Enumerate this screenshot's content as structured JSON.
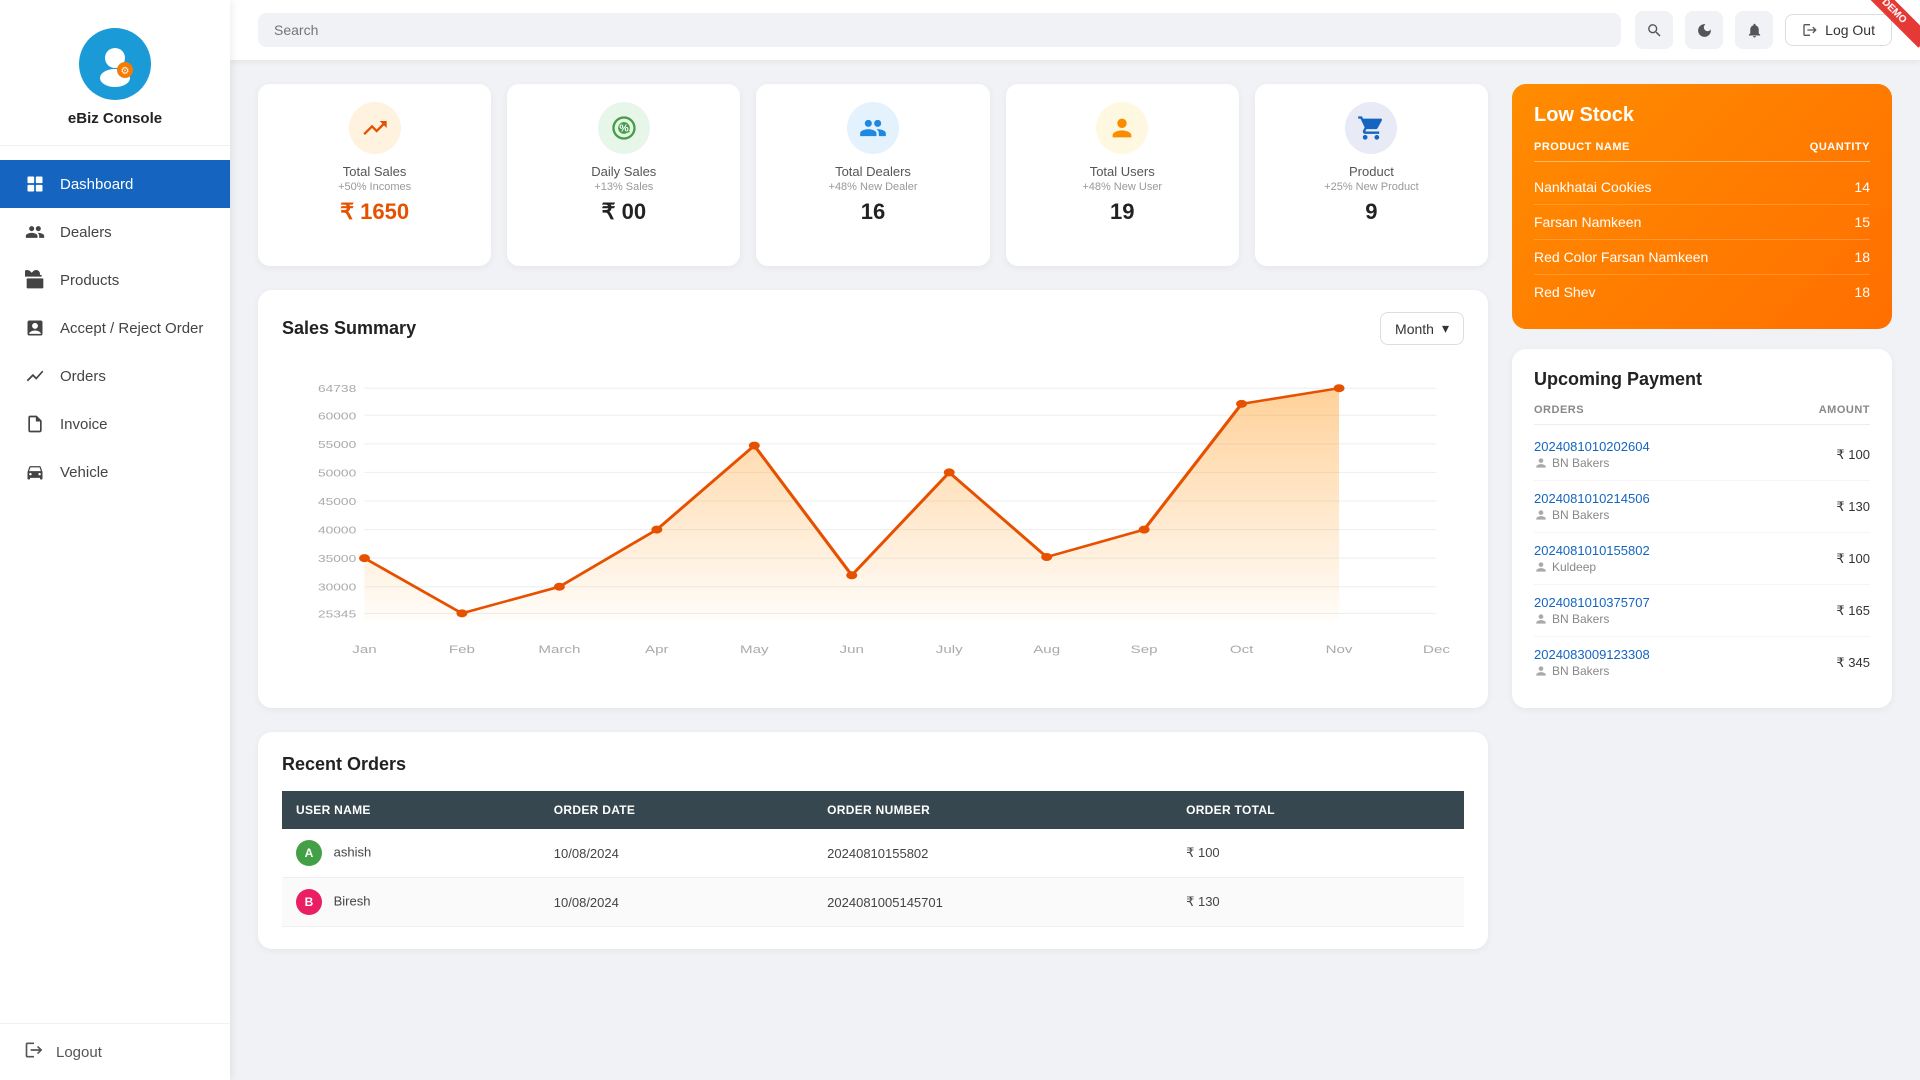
{
  "brand": "eBiz Console",
  "topbar": {
    "search_placeholder": "Search",
    "logout_label": "Log Out"
  },
  "sidebar": {
    "items": [
      {
        "id": "dashboard",
        "label": "Dashboard",
        "active": true
      },
      {
        "id": "dealers",
        "label": "Dealers"
      },
      {
        "id": "products",
        "label": "Products"
      },
      {
        "id": "accept-reject",
        "label": "Accept / Reject Order"
      },
      {
        "id": "orders",
        "label": "Orders"
      },
      {
        "id": "invoice",
        "label": "Invoice"
      },
      {
        "id": "vehicle",
        "label": "Vehicle"
      }
    ],
    "logout": "Logout"
  },
  "stats": [
    {
      "id": "total-sales",
      "icon_color": "#e65100",
      "icon": "chart-up",
      "label": "Total Sales",
      "sub": "+50% Incomes",
      "value": "₹ 1650",
      "orange": true
    },
    {
      "id": "daily-sales",
      "icon_color": "#43a047",
      "icon": "percent",
      "label": "Daily Sales",
      "sub": "+13% Sales",
      "value": "₹ 00",
      "orange": false
    },
    {
      "id": "total-dealers",
      "icon_color": "#1e88e5",
      "icon": "group",
      "label": "Total Dealers",
      "sub": "+48% New Dealer",
      "value": "16",
      "orange": false
    },
    {
      "id": "total-users",
      "icon_color": "#fb8c00",
      "icon": "person",
      "label": "Total Users",
      "sub": "+48% New User",
      "value": "19",
      "orange": false
    },
    {
      "id": "product",
      "icon_color": "#1565c0",
      "icon": "cart",
      "label": "Product",
      "sub": "+25% New Product",
      "value": "9",
      "orange": false
    }
  ],
  "low_stock": {
    "title": "Low Stock",
    "col_name": "PRODUCT NAME",
    "col_qty": "QUANTITY",
    "items": [
      {
        "name": "Nankhatai Cookies",
        "qty": 14
      },
      {
        "name": "Farsan Namkeen",
        "qty": 15
      },
      {
        "name": "Red Color Farsan Namkeen",
        "qty": 18
      },
      {
        "name": "Red Shev",
        "qty": 18
      }
    ]
  },
  "upcoming_payment": {
    "title": "Upcoming Payment",
    "col_orders": "ORDERS",
    "col_amount": "AMOUNT",
    "items": [
      {
        "order_id": "2024081010202604",
        "user": "BN Bakers",
        "amount": "₹ 100"
      },
      {
        "order_id": "2024081010214506",
        "user": "BN Bakers",
        "amount": "₹ 130"
      },
      {
        "order_id": "2024081010155802",
        "user": "Kuldeep",
        "amount": "₹ 100"
      },
      {
        "order_id": "2024081010375707",
        "user": "BN Bakers",
        "amount": "₹ 165"
      },
      {
        "order_id": "2024083009123308",
        "user": "BN Bakers",
        "amount": "₹ 345"
      }
    ]
  },
  "sales_summary": {
    "title": "Sales Summary",
    "period_label": "Month",
    "y_labels": [
      "64738",
      "60000",
      "55000",
      "50000",
      "45000",
      "40000",
      "35000",
      "30000",
      "25345"
    ],
    "x_labels": [
      "Jan",
      "Feb",
      "March",
      "Apr",
      "May",
      "Jun",
      "July",
      "Aug",
      "Sep",
      "Oct",
      "Nov",
      "Dec"
    ],
    "data_points": [
      35000,
      25345,
      30000,
      40000,
      54700,
      32000,
      50000,
      35200,
      40000,
      62000,
      64738,
      0
    ],
    "chart_min": 25000,
    "chart_max": 66000
  },
  "recent_orders": {
    "title": "Recent Orders",
    "columns": [
      "USER NAME",
      "ORDER DATE",
      "ORDER NUMBER",
      "ORDER TOTAL"
    ],
    "rows": [
      {
        "user": "ashish",
        "avatar_color": "#43a047",
        "date": "10/08/2024",
        "order_num": "20240810155802",
        "total": "₹ 100"
      },
      {
        "user": "Biresh",
        "avatar_color": "#e91e63",
        "date": "10/08/2024",
        "order_num": "20240810051457​01",
        "total": "₹ 130"
      }
    ]
  },
  "ribbon": "DEMO"
}
